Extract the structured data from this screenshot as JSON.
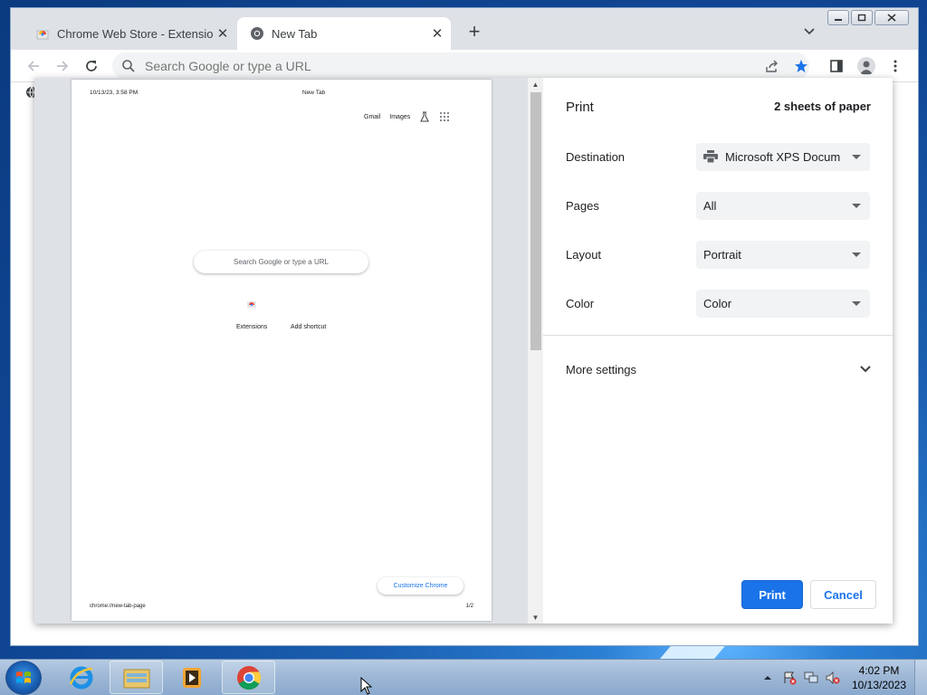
{
  "browser": {
    "tabs": [
      {
        "title": "Chrome Web Store - Extensions",
        "active": false
      },
      {
        "title": "New Tab",
        "active": true
      }
    ],
    "omnibox_placeholder": "Search Google or type a URL"
  },
  "print_preview": {
    "header_date": "10/13/23, 3:58 PM",
    "header_title": "New Tab",
    "links": [
      "Gmail",
      "Images"
    ],
    "search_placeholder": "Search Google or type a URL",
    "shortcuts": [
      "Extensions",
      "Add shortcut"
    ],
    "customize_label": "Customize Chrome",
    "footer_url": "chrome://new-tab-page",
    "footer_page": "1/2"
  },
  "print_settings": {
    "title": "Print",
    "sheets": "2 sheets of paper",
    "rows": [
      {
        "label": "Destination",
        "value": "Microsoft XPS Docum"
      },
      {
        "label": "Pages",
        "value": "All"
      },
      {
        "label": "Layout",
        "value": "Portrait"
      },
      {
        "label": "Color",
        "value": "Color"
      }
    ],
    "more_settings": "More settings",
    "print_button": "Print",
    "cancel_button": "Cancel"
  },
  "taskbar": {
    "time": "4:02 PM",
    "date": "10/13/2023"
  },
  "colors": {
    "accent": "#1a73e8",
    "tabstrip": "#dee1e6"
  }
}
